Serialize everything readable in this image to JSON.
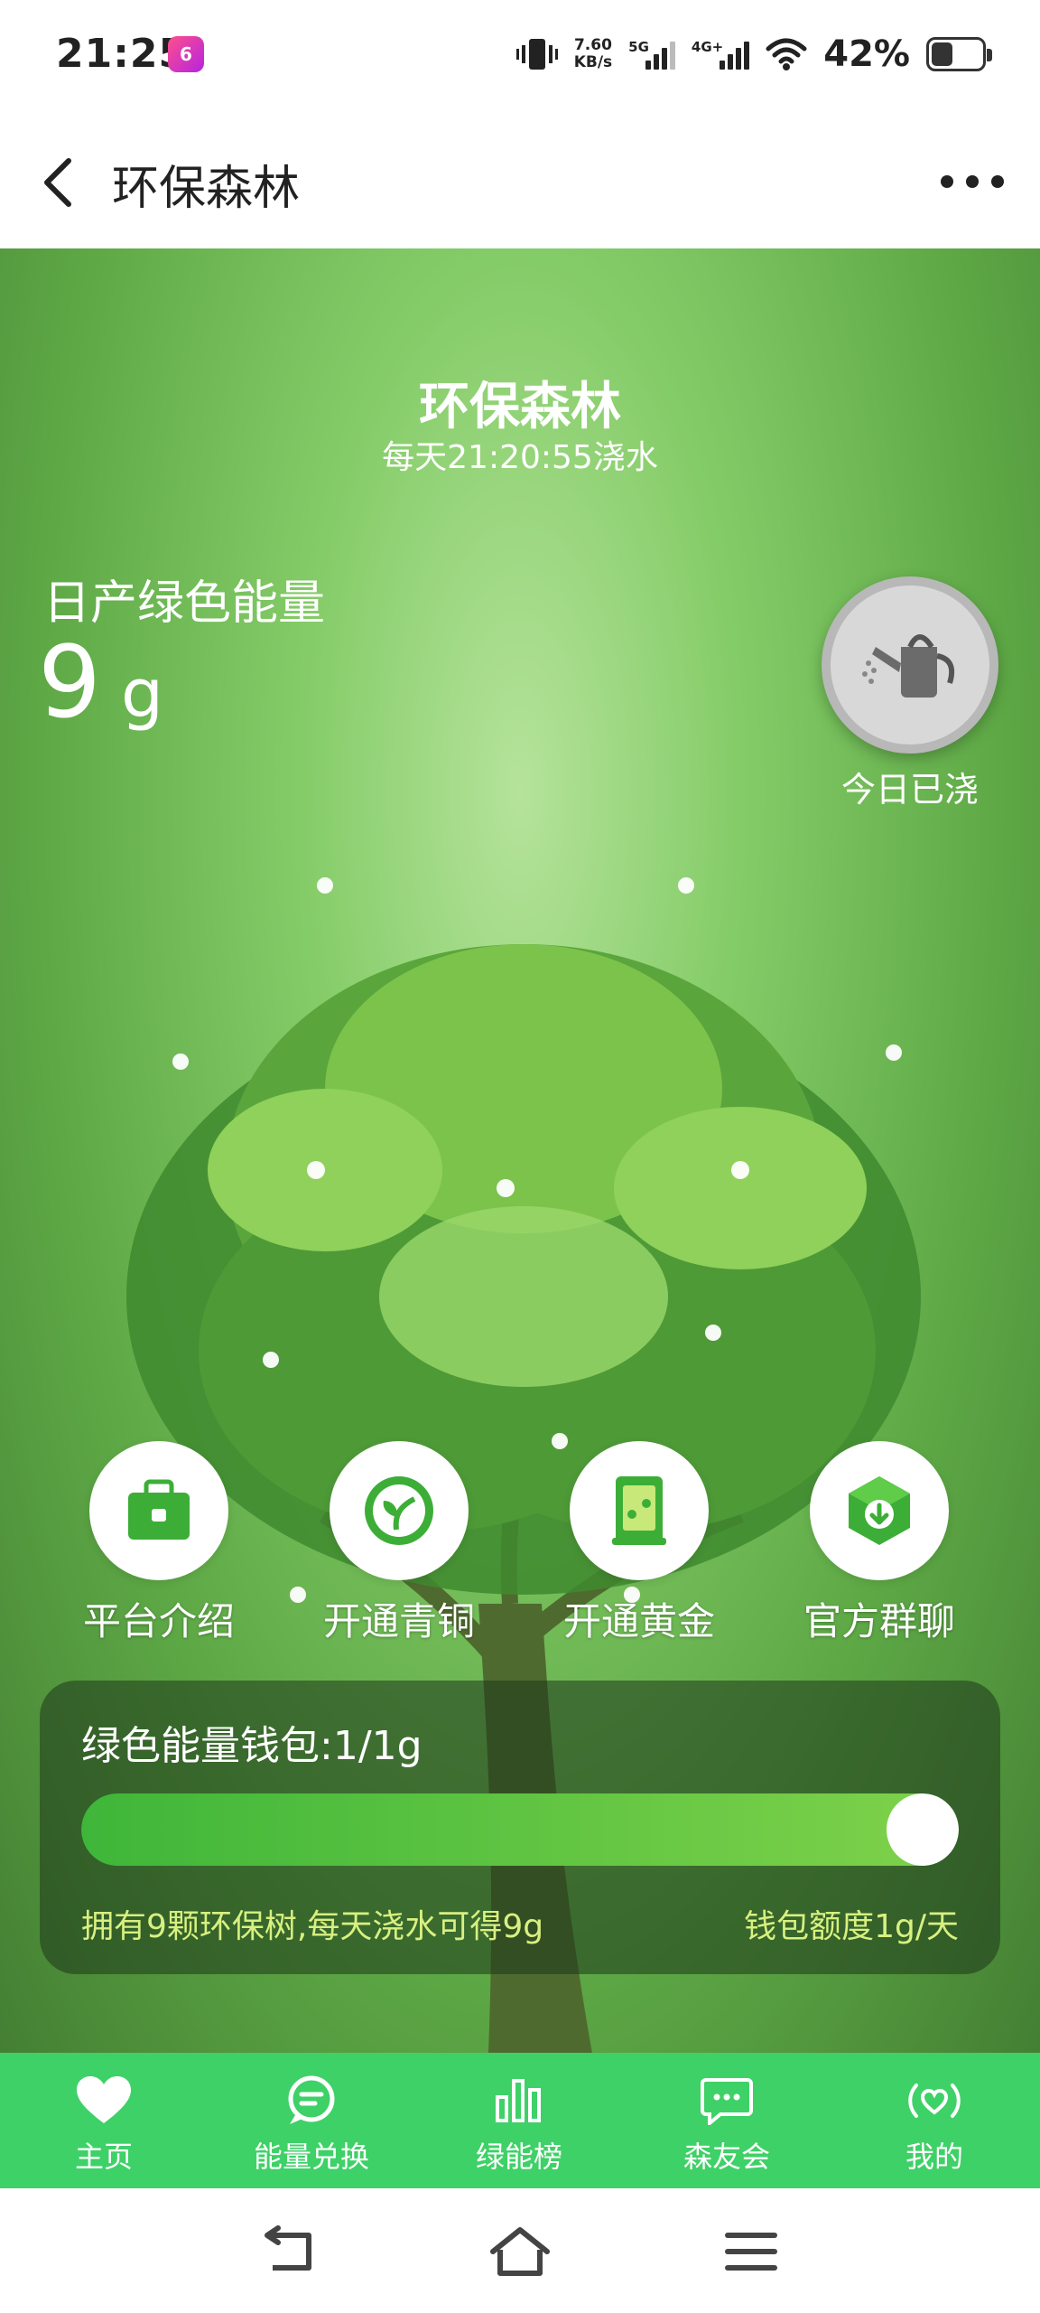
{
  "status_bar": {
    "time": "21:25",
    "app_badge": "6",
    "net_speed_value": "7.60",
    "net_speed_unit": "KB/s",
    "sim1": "5G",
    "sim2": "4G+",
    "battery": "42%"
  },
  "header": {
    "title": "环保森林"
  },
  "hero": {
    "title": "环保森林",
    "subtitle": "每天21:20:55浇水",
    "energy_label": "日产绿色能量",
    "energy_value": "9",
    "energy_unit": "g",
    "water_label": "今日已浇"
  },
  "actions": [
    {
      "label": "平台介绍",
      "icon": "bag-icon"
    },
    {
      "label": "开通青铜",
      "icon": "sprout-icon"
    },
    {
      "label": "开通黄金",
      "icon": "card-icon"
    },
    {
      "label": "官方群聊",
      "icon": "hex-download-icon"
    }
  ],
  "wallet": {
    "title": "绿色能量钱包:1/1g",
    "progress": 1.0,
    "note": "拥有9颗环保树,每天浇水可得9g",
    "quota": "钱包额度1g/天"
  },
  "tabs": [
    {
      "label": "主页",
      "icon": "heart-icon"
    },
    {
      "label": "能量兑换",
      "icon": "chat-icon"
    },
    {
      "label": "绿能榜",
      "icon": "bar-chart-icon"
    },
    {
      "label": "森友会",
      "icon": "message-icon"
    },
    {
      "label": "我的",
      "icon": "broadcast-heart-icon"
    }
  ],
  "colors": {
    "accent": "#3ed167",
    "wallet_text": "#d8f080"
  }
}
